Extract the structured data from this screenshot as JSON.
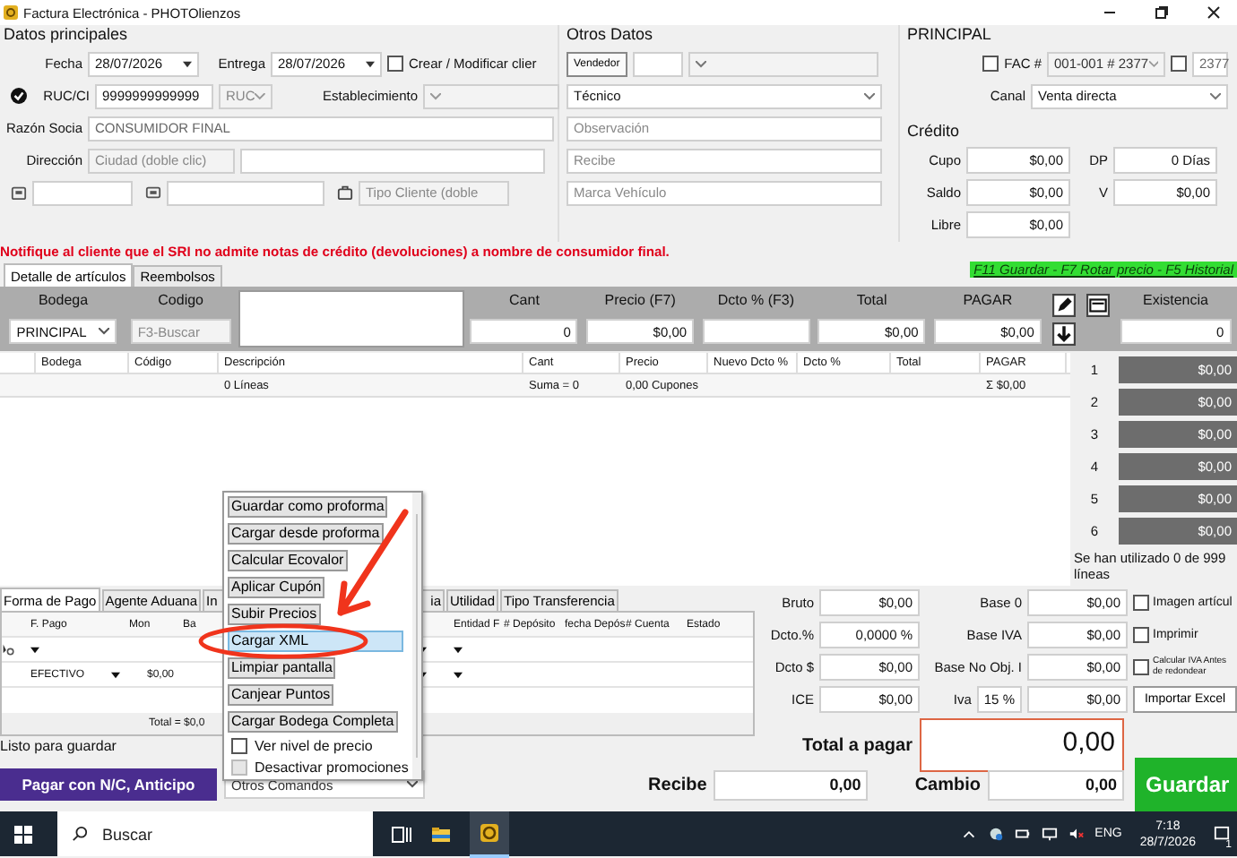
{
  "window": {
    "title": "Factura Electrónica - PHOTOlienzos"
  },
  "datos_principales": {
    "title": "Datos principales",
    "fecha": {
      "label": "Fecha",
      "value": "28/07/2026"
    },
    "entrega": {
      "label": "Entrega",
      "value": "28/07/2026"
    },
    "crear_cliente": {
      "label": "Crear / Modificar clier",
      "checked": false
    },
    "ruc": {
      "label": "RUC/CI",
      "value": "9999999999999",
      "verified": true
    },
    "tipo_id": "RUC",
    "establecimiento": {
      "label": "Establecimiento"
    },
    "razon_social": {
      "label": "Razón Socia",
      "value": "CONSUMIDOR FINAL"
    },
    "direccion": {
      "label": "Dirección",
      "placeholder": "Ciudad (doble clic)"
    },
    "tipo_cliente": {
      "placeholder": "Tipo Cliente (doble"
    }
  },
  "otros_datos": {
    "title": "Otros Datos",
    "vendedor_button": "Vendedor",
    "tecnico": "Técnico",
    "fields": [
      {
        "placeholder": "Observación"
      },
      {
        "placeholder": "Recibe"
      },
      {
        "placeholder": "Marca Vehículo"
      }
    ]
  },
  "principal": {
    "title": "PRINCIPAL",
    "fac": {
      "label": "FAC #",
      "checked": false,
      "value": "001-001 # 2377"
    },
    "secuencial": {
      "checked": false,
      "value": "2377"
    },
    "canal": {
      "label": "Canal",
      "value": "Venta directa"
    },
    "credito": {
      "title": "Crédito",
      "fields": [
        {
          "label": "Cupo",
          "value": "$0,00"
        },
        {
          "label": "DP",
          "value": "0 Días"
        },
        {
          "label": "Saldo",
          "value": "$0,00"
        },
        {
          "label": "V",
          "value": "$0,00"
        },
        {
          "label": "Libre",
          "value": "$0,00"
        }
      ]
    }
  },
  "notice": "Notifique al cliente que el SRI no admite notas de crédito (devoluciones) a nombre de consumidor final.",
  "shortcuts": "F11 Guardar - F7 Rotar precio - F5 Historial",
  "detail_tabs": [
    {
      "label": "Detalle de artículos",
      "selected": true
    },
    {
      "label": "Reembolsos",
      "selected": false
    }
  ],
  "entry": {
    "columns": [
      "Bodega",
      "Codigo",
      "Cant",
      "Precio (F7)",
      "Dcto % (F3)",
      "Total",
      "PAGAR"
    ],
    "bodega": "PRINCIPAL",
    "codigo_placeholder": "F3-Buscar",
    "cant": "0",
    "precio": "$0,00",
    "total": "$0,00",
    "pagar": "$0,00",
    "existencia_label": "Existencia",
    "existencia": "0"
  },
  "items_table": {
    "columns": [
      "Bodega",
      "Código",
      "Descripción",
      "Cant",
      "Precio",
      "Nuevo Dcto %",
      "Dcto %",
      "Total",
      "PAGAR"
    ],
    "summary": {
      "lineas": "0 Líneas",
      "suma": "Suma = 0",
      "cupones": "0,00 Cupones",
      "pagar": "Σ $0,00"
    }
  },
  "price_levels": [
    {
      "number": "1",
      "value": "$0,00"
    },
    {
      "number": "2",
      "value": "$0,00"
    },
    {
      "number": "3",
      "value": "$0,00"
    },
    {
      "number": "4",
      "value": "$0,00"
    },
    {
      "number": "5",
      "value": "$0,00"
    },
    {
      "number": "6",
      "value": "$0,00"
    }
  ],
  "lines_used": "Se han utilizado 0 de 999 líneas",
  "payment_tabs": [
    {
      "label": "Forma de Pago",
      "selected": true
    },
    {
      "label": "Agente Aduana",
      "selected": false
    },
    {
      "label": "In",
      "selected": false
    },
    {
      "label": "ia",
      "selected": false
    },
    {
      "label": "Utilidad",
      "selected": false
    },
    {
      "label": "Tipo Transferencia",
      "selected": false
    }
  ],
  "payments_table": {
    "columns_left": [
      "F. Pago",
      "Mon",
      "Ba"
    ],
    "columns_right": [
      "Entidad F",
      "# Depósito",
      "fecha Depós",
      "# Cuenta",
      "Estado"
    ],
    "rows": [
      {
        "f_pago": "EFECTIVO",
        "monto": "$0,00"
      }
    ],
    "total": "Total = $0,0"
  },
  "status": "Listo para guardar",
  "totals": [
    {
      "label": "Bruto",
      "value": "$0,00"
    },
    {
      "label": "Dcto.%",
      "value": "0,0000 %"
    },
    {
      "label": "Dcto $",
      "value": "$0,00"
    },
    {
      "label": "ICE",
      "value": "$0,00"
    }
  ],
  "bases": [
    {
      "label": "Base 0",
      "value": "$0,00"
    },
    {
      "label": "Base IVA",
      "value": "$0,00"
    },
    {
      "label": "Base No Obj. I",
      "value": "$0,00"
    },
    {
      "label": "Iva",
      "rate": "15 %",
      "value": "$0,00"
    }
  ],
  "options": [
    {
      "label": "Imagen artícul",
      "checked": false
    },
    {
      "label": "Imprimir",
      "checked": false
    },
    {
      "label": "Calcular IVA Antes de redondear",
      "checked": false
    }
  ],
  "import_button": "Importar Excel",
  "total_a_pagar": {
    "label": "Total a pagar",
    "value": "0,00"
  },
  "footer": {
    "pagar_button": "Pagar con N/C, Anticipo",
    "otros_comandos": "Otros Comandos",
    "recibe": {
      "label": "Recibe",
      "value": "0,00"
    },
    "cambio": {
      "label": "Cambio",
      "value": "0,00"
    },
    "guardar": "Guardar"
  },
  "menu": {
    "items": [
      {
        "kind": "button",
        "label": "Guardar como proforma",
        "selected": false
      },
      {
        "kind": "button",
        "label": "Cargar desde proforma",
        "selected": false
      },
      {
        "kind": "button",
        "label": "Calcular Ecovalor",
        "selected": false
      },
      {
        "kind": "button",
        "label": "Aplicar Cupón",
        "selected": false
      },
      {
        "kind": "button",
        "label": "Subir Precios",
        "selected": false
      },
      {
        "kind": "button",
        "label": "Cargar XML",
        "selected": true
      },
      {
        "kind": "button",
        "label": "Limpiar pantalla",
        "selected": false
      },
      {
        "kind": "button",
        "label": "Canjear Puntos",
        "selected": false
      },
      {
        "kind": "button",
        "label": "Cargar Bodega Completa",
        "selected": false
      },
      {
        "kind": "checkbox",
        "label": "Ver nivel de precio",
        "selected": false,
        "checked": false,
        "disabled": false
      },
      {
        "kind": "checkbox",
        "label": "Desactivar promociones",
        "selected": false,
        "checked": false,
        "disabled": true
      }
    ]
  },
  "taskbar": {
    "search_placeholder": "Buscar",
    "language": "ENG",
    "time": "7:18",
    "date": "28/7/2026",
    "notifications": "1"
  }
}
